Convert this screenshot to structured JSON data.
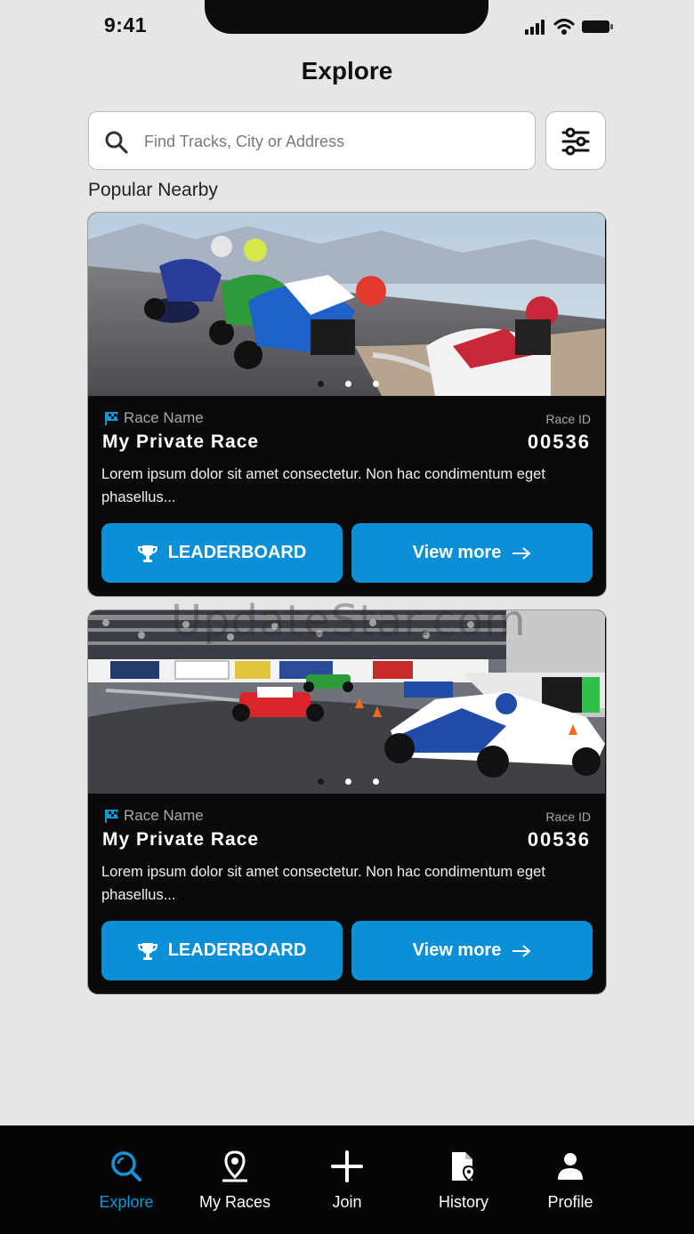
{
  "status": {
    "time": "9:41"
  },
  "header": {
    "title": "Explore"
  },
  "search": {
    "placeholder": "Find Tracks, City or Address"
  },
  "section": {
    "title": "Popular Nearby"
  },
  "cards": [
    {
      "race_name_label": "Race Name",
      "title": "My Private Race",
      "race_id_label": "Race ID",
      "race_id": "00536",
      "description": "Lorem ipsum dolor sit amet consectetur. Non hac condimentum eget phasellus...",
      "leaderboard_label": "LEADERBOARD",
      "view_more_label": "View more",
      "image": "motorcycle-race-photo"
    },
    {
      "race_name_label": "Race Name",
      "title": "My Private Race",
      "race_id_label": "Race ID",
      "race_id": "00536",
      "description": "Lorem ipsum dolor sit amet consectetur. Non hac condimentum eget phasellus...",
      "leaderboard_label": "LEADERBOARD",
      "view_more_label": "View more",
      "image": "formula-race-photo"
    }
  ],
  "watermark": "UpdateStar.com",
  "nav": {
    "items": [
      {
        "label": "Explore",
        "icon": "search-icon",
        "active": true
      },
      {
        "label": "My Races",
        "icon": "location-pin-icon",
        "active": false
      },
      {
        "label": "Join",
        "icon": "plus-icon",
        "active": false
      },
      {
        "label": "History",
        "icon": "document-pin-icon",
        "active": false
      },
      {
        "label": "Profile",
        "icon": "person-icon",
        "active": false
      }
    ]
  },
  "colors": {
    "accent": "#0b8fd6",
    "active_nav": "#1096d8",
    "card_bg": "#0a0a0a",
    "page_bg": "#e6e6e6"
  }
}
